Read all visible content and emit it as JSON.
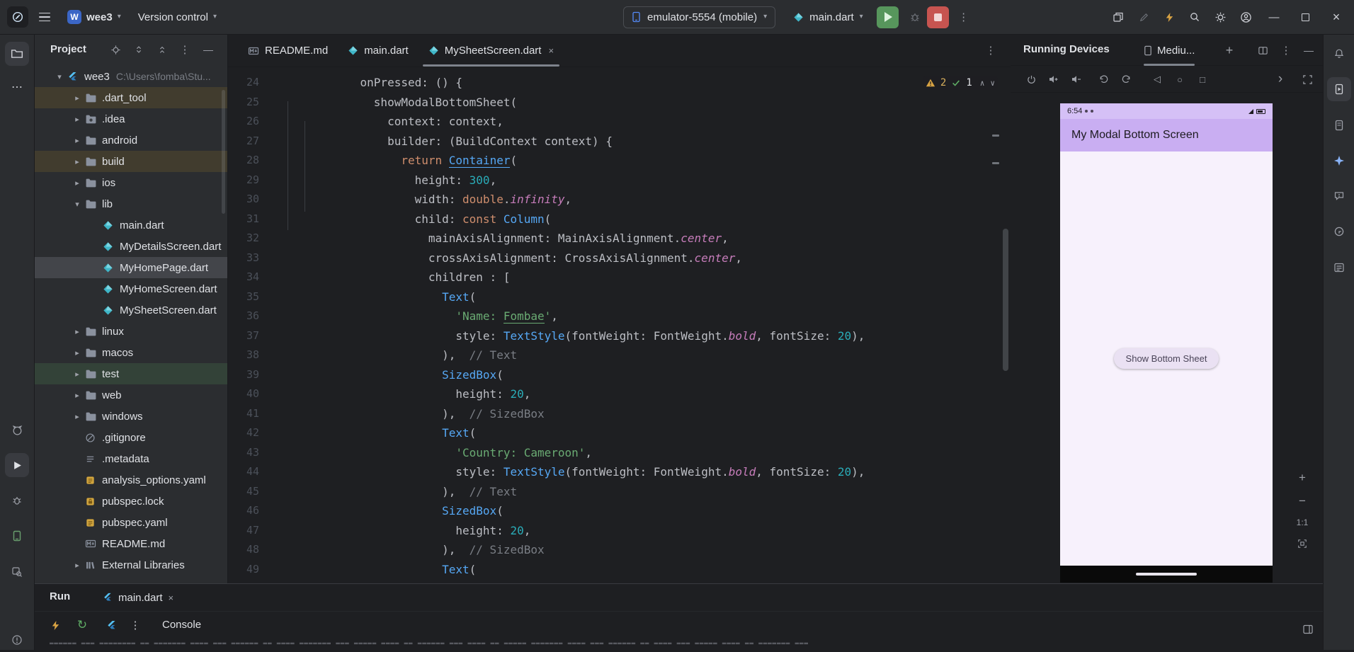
{
  "titlebar": {
    "project_name": "wee3",
    "project_avatar": "W",
    "vcs_label": "Version control",
    "device_selector": "emulator-5554 (mobile)",
    "run_config": "main.dart"
  },
  "project": {
    "title": "Project",
    "items": [
      {
        "label": "wee3",
        "path": "C:\\Users\\fomba\\Stu...",
        "depth": 0,
        "icon": "flutter",
        "chevron": "open"
      },
      {
        "label": ".dart_tool",
        "depth": 1,
        "icon": "folder",
        "chevron": "closed",
        "tint": "ex"
      },
      {
        "label": ".idea",
        "depth": 1,
        "icon": "folder_idea",
        "chevron": "closed"
      },
      {
        "label": "android",
        "depth": 1,
        "icon": "folder",
        "chevron": "closed"
      },
      {
        "label": "build",
        "depth": 1,
        "icon": "folder",
        "chevron": "closed",
        "tint": "ex"
      },
      {
        "label": "ios",
        "depth": 1,
        "icon": "folder",
        "chevron": "closed"
      },
      {
        "label": "lib",
        "depth": 1,
        "icon": "folder",
        "chevron": "open"
      },
      {
        "label": "main.dart",
        "depth": 2,
        "icon": "dart",
        "chevron": ""
      },
      {
        "label": "MyDetailsScreen.dart",
        "depth": 2,
        "icon": "dart",
        "chevron": ""
      },
      {
        "label": "MyHomePage.dart",
        "depth": 2,
        "icon": "dart",
        "chevron": "",
        "selected": true
      },
      {
        "label": "MyHomeScreen.dart",
        "depth": 2,
        "icon": "dart",
        "chevron": ""
      },
      {
        "label": "MySheetScreen.dart",
        "depth": 2,
        "icon": "dart",
        "chevron": ""
      },
      {
        "label": "linux",
        "depth": 1,
        "icon": "folder",
        "chevron": "closed"
      },
      {
        "label": "macos",
        "depth": 1,
        "icon": "folder",
        "chevron": "closed"
      },
      {
        "label": "test",
        "depth": 1,
        "icon": "folder",
        "chevron": "closed",
        "tint": "test"
      },
      {
        "label": "web",
        "depth": 1,
        "icon": "folder",
        "chevron": "closed"
      },
      {
        "label": "windows",
        "depth": 1,
        "icon": "folder",
        "chevron": "closed"
      },
      {
        "label": ".gitignore",
        "depth": 1,
        "icon": "git",
        "chevron": ""
      },
      {
        "label": ".metadata",
        "depth": 1,
        "icon": "text",
        "chevron": ""
      },
      {
        "label": "analysis_options.yaml",
        "depth": 1,
        "icon": "yaml",
        "chevron": ""
      },
      {
        "label": "pubspec.lock",
        "depth": 1,
        "icon": "lock",
        "chevron": ""
      },
      {
        "label": "pubspec.yaml",
        "depth": 1,
        "icon": "yaml",
        "chevron": ""
      },
      {
        "label": "README.md",
        "depth": 1,
        "icon": "md",
        "chevron": ""
      },
      {
        "label": "External Libraries",
        "depth": 1,
        "icon": "lib",
        "chevron": "closed"
      }
    ]
  },
  "editor_tabs": [
    {
      "label": "README.md",
      "icon": "md",
      "active": false,
      "closable": false
    },
    {
      "label": "main.dart",
      "icon": "dart",
      "active": false,
      "closable": false
    },
    {
      "label": "MySheetScreen.dart",
      "icon": "dart",
      "active": true,
      "closable": true
    }
  ],
  "editor": {
    "inspections": {
      "warnings": "2",
      "passed": "1"
    },
    "code": [
      {
        "n": "24",
        "t": [
          [
            "    onPressed: () {",
            "p"
          ]
        ]
      },
      {
        "n": "25",
        "t": [
          [
            "      showModalBottomSheet(",
            "p"
          ]
        ]
      },
      {
        "n": "26",
        "t": [
          [
            "        context: context,",
            "p"
          ]
        ]
      },
      {
        "n": "27",
        "t": [
          [
            "        builder: (BuildContext context) {",
            "p"
          ]
        ]
      },
      {
        "n": "28",
        "t": [
          [
            "          ",
            "p"
          ],
          [
            "return ",
            "k"
          ],
          [
            "Container",
            "cu"
          ],
          [
            "(",
            "p"
          ]
        ]
      },
      {
        "n": "29",
        "t": [
          [
            "            height: ",
            "p"
          ],
          [
            "300",
            "n"
          ],
          [
            ",",
            "p"
          ]
        ]
      },
      {
        "n": "30",
        "t": [
          [
            "            width: ",
            "p"
          ],
          [
            "double",
            "k"
          ],
          [
            ".",
            "p"
          ],
          [
            "infinity",
            "f"
          ],
          [
            ",",
            "p"
          ]
        ]
      },
      {
        "n": "31",
        "t": [
          [
            "            child: ",
            "p"
          ],
          [
            "const ",
            "k"
          ],
          [
            "Column",
            "c"
          ],
          [
            "(",
            "p"
          ]
        ]
      },
      {
        "n": "32",
        "t": [
          [
            "              mainAxisAlignment: MainAxisAlignment.",
            "p"
          ],
          [
            "center",
            "f"
          ],
          [
            ",",
            "p"
          ]
        ]
      },
      {
        "n": "33",
        "t": [
          [
            "              crossAxisAlignment: CrossAxisAlignment.",
            "p"
          ],
          [
            "center",
            "f"
          ],
          [
            ",",
            "p"
          ]
        ]
      },
      {
        "n": "34",
        "t": [
          [
            "              children : [",
            "p"
          ]
        ]
      },
      {
        "n": "35",
        "t": [
          [
            "                ",
            "p"
          ],
          [
            "Text",
            "c"
          ],
          [
            "(",
            "p"
          ]
        ]
      },
      {
        "n": "36",
        "t": [
          [
            "                  ",
            "p"
          ],
          [
            "'Name: ",
            "s"
          ],
          [
            "Fombae",
            "st"
          ],
          [
            "'",
            "s"
          ],
          [
            ",",
            "p"
          ]
        ]
      },
      {
        "n": "37",
        "t": [
          [
            "                  style: ",
            "p"
          ],
          [
            "TextStyle",
            "c"
          ],
          [
            "(fontWeight: FontWeight.",
            "p"
          ],
          [
            "bold",
            "f"
          ],
          [
            ", fontSize: ",
            "p"
          ],
          [
            "20",
            "n"
          ],
          [
            "),",
            "p"
          ]
        ]
      },
      {
        "n": "38",
        "t": [
          [
            "                ),  ",
            "p"
          ],
          [
            "// Text",
            "cm"
          ]
        ]
      },
      {
        "n": "39",
        "t": [
          [
            "                ",
            "p"
          ],
          [
            "SizedBox",
            "c"
          ],
          [
            "(",
            "p"
          ]
        ]
      },
      {
        "n": "40",
        "t": [
          [
            "                  height: ",
            "p"
          ],
          [
            "20",
            "n"
          ],
          [
            ",",
            "p"
          ]
        ]
      },
      {
        "n": "41",
        "t": [
          [
            "                ),  ",
            "p"
          ],
          [
            "// SizedBox",
            "cm"
          ]
        ]
      },
      {
        "n": "42",
        "t": [
          [
            "                ",
            "p"
          ],
          [
            "Text",
            "c"
          ],
          [
            "(",
            "p"
          ]
        ]
      },
      {
        "n": "43",
        "t": [
          [
            "                  ",
            "p"
          ],
          [
            "'Country: Cameroon'",
            "s"
          ],
          [
            ",",
            "p"
          ]
        ]
      },
      {
        "n": "44",
        "t": [
          [
            "                  style: ",
            "p"
          ],
          [
            "TextStyle",
            "c"
          ],
          [
            "(fontWeight: FontWeight.",
            "p"
          ],
          [
            "bold",
            "f"
          ],
          [
            ", fontSize: ",
            "p"
          ],
          [
            "20",
            "n"
          ],
          [
            "),",
            "p"
          ]
        ]
      },
      {
        "n": "45",
        "t": [
          [
            "                ),  ",
            "p"
          ],
          [
            "// Text",
            "cm"
          ]
        ]
      },
      {
        "n": "46",
        "t": [
          [
            "                ",
            "p"
          ],
          [
            "SizedBox",
            "c"
          ],
          [
            "(",
            "p"
          ]
        ]
      },
      {
        "n": "47",
        "t": [
          [
            "                  height: ",
            "p"
          ],
          [
            "20",
            "n"
          ],
          [
            ",",
            "p"
          ]
        ]
      },
      {
        "n": "48",
        "t": [
          [
            "                ),  ",
            "p"
          ],
          [
            "// SizedBox",
            "cm"
          ]
        ]
      },
      {
        "n": "49",
        "t": [
          [
            "                ",
            "p"
          ],
          [
            "Text",
            "c"
          ],
          [
            "(",
            "p"
          ]
        ]
      }
    ]
  },
  "devices": {
    "panel_title": "Running Devices",
    "tab_label": "Mediu...",
    "emulator": {
      "time": "6:54",
      "appbar_title": "My Modal Bottom Screen",
      "button_label": "Show Bottom Sheet"
    },
    "zoom_label": "1:1"
  },
  "run": {
    "title": "Run",
    "tab_label": "main.dart",
    "console_label": "Console",
    "ticker": "══════ ═══ ════════ ══ ═══════ ════ ═══ ══════ ══ ════ ═══════ ═══ ═════ ════ ══ ══════ ═══ ════ ══ ═════ ═══════ ════ ═══ ══════ ══ ════ ═══ ═════ ════ ══ ═══════ ═══"
  },
  "icons": {
    "kebab": "⋮",
    "more_h": "⋯",
    "chevron_down": "▾",
    "tree_open": "▾",
    "tree_closed": "▸",
    "close": "×",
    "minimize": "—",
    "back": "◁",
    "home": "○",
    "overview": "□",
    "chevron_right": "›",
    "restart": "↻",
    "plus": "+",
    "minus": "−",
    "up": "∧",
    "down": "∨"
  }
}
